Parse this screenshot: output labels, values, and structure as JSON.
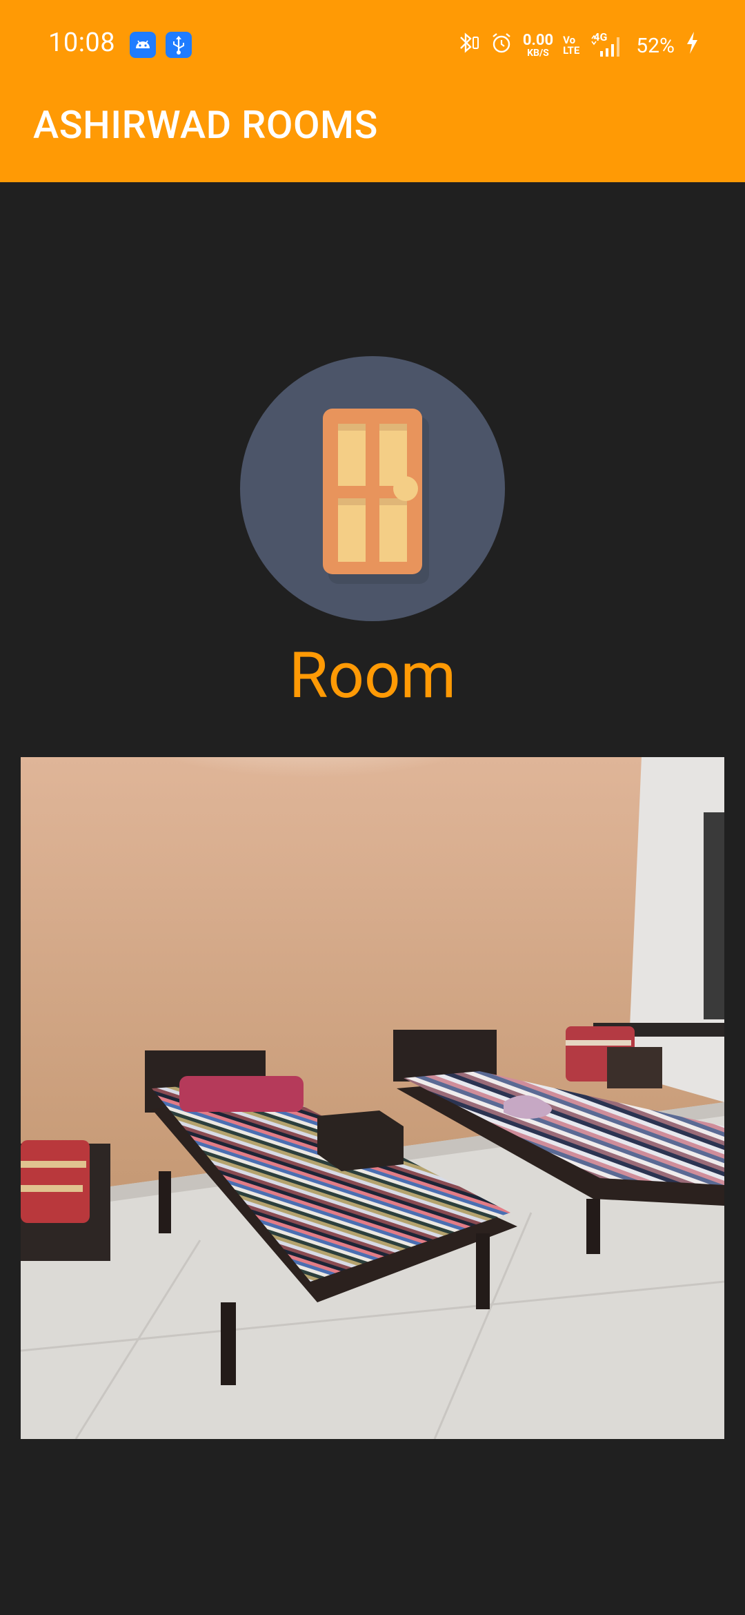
{
  "status_bar": {
    "time": "10:08",
    "net_speed_value": "0.00",
    "net_speed_unit": "KB/S",
    "volte_top": "Vo",
    "volte_bottom": "LTE",
    "network_type": "4G",
    "battery": "52%",
    "icons": [
      "android-debug-icon",
      "usb-icon",
      "bluetooth-icon",
      "alarm-icon",
      "signal-icon",
      "charging-icon"
    ]
  },
  "app_bar": {
    "title": "ASHIRWAD ROOMS",
    "color": "#FF9A05"
  },
  "content": {
    "category_icon": "door-icon",
    "category_label": "Room",
    "photo_subject": "room-photo"
  },
  "colors": {
    "background": "#202020",
    "accent": "#FF9A05",
    "icon_circle": "#4C5569"
  }
}
